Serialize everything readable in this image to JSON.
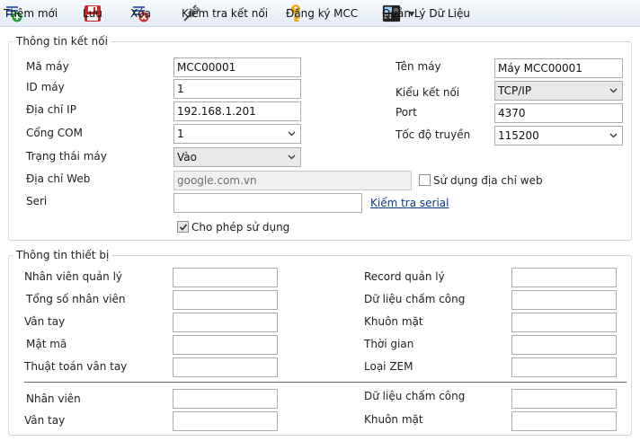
{
  "toolbar": {
    "add": "Thêm mới",
    "save": "Lưu",
    "delete": "Xóa",
    "check_connection": "Kiểm tra kết nối",
    "register_mcc": "Đăng ký MCC",
    "manage_data": "Quản Lý Dữ Liệu"
  },
  "connection": {
    "title": "Thông tin kết nối",
    "machine_code_label": "Mã máy",
    "machine_code": "MCC00001",
    "machine_name_label": "Tên máy",
    "machine_name": "Máy MCC00001",
    "machine_id_label": "ID máy",
    "machine_id": "1",
    "connection_type_label": "Kiểu kết nối",
    "connection_type": "TCP/IP",
    "ip_label": "Địa chỉ IP",
    "ip": "192.168.1.201",
    "port_label": "Port",
    "port": "4370",
    "com_label": "Cổng COM",
    "com": "1",
    "baud_label": "Tốc độ truyền",
    "baud": "115200",
    "status_label": "Trạng thái máy",
    "status": "Vào",
    "web_label": "Địa chỉ Web",
    "web_value": "google.com.vn",
    "use_web_label": "Sử dụng địa chỉ web",
    "use_web_checked": false,
    "serial_label": "Seri",
    "serial": "",
    "check_serial_link": "Kiểm tra serial",
    "allow_use_label": "Cho phép sử dụng",
    "allow_use_checked": true
  },
  "device": {
    "title": "Thông tin thiết bị",
    "managed_staff_label": "Nhân viên quản lý",
    "record_managed_label": "Record quản lý",
    "total_staff_label": "Tổng số nhân viên",
    "attendance_data_label": "Dữ liệu chấm công",
    "fingerprint_label": "Vân tay",
    "face_label": "Khuôn mặt",
    "password_label": "Mật mã",
    "time_label": "Thời gian",
    "fp_algorithm_label": "Thuật toán vân tay",
    "zem_type_label": "Loại ZEM",
    "staff_label": "Nhân viên",
    "attendance_data_label_2": "Dữ liệu chấm công",
    "fingerprint_label_2": "Vân tay",
    "face_label_2": "Khuôn mặt"
  }
}
